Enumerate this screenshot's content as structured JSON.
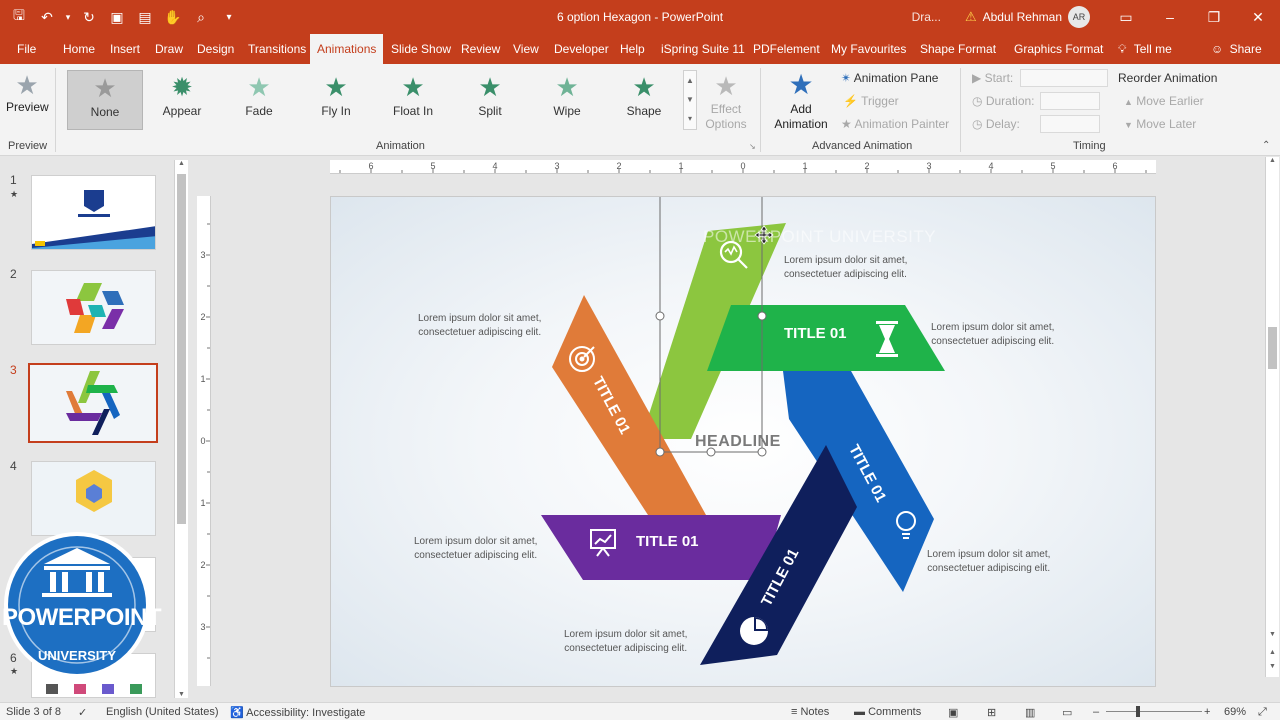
{
  "titlebar": {
    "doc_title": "6 option Hexagon  -  PowerPoint",
    "draw_label": "Dra...",
    "user_name": "Abdul Rehman",
    "user_initials": "AR"
  },
  "tabs": [
    {
      "label": "File"
    },
    {
      "label": "Home"
    },
    {
      "label": "Insert"
    },
    {
      "label": "Draw"
    },
    {
      "label": "Design"
    },
    {
      "label": "Transitions"
    },
    {
      "label": "Animations"
    },
    {
      "label": "Slide Show"
    },
    {
      "label": "Review"
    },
    {
      "label": "View"
    },
    {
      "label": "Developer"
    },
    {
      "label": "Help"
    },
    {
      "label": "iSpring Suite 11"
    },
    {
      "label": "PDFelement"
    },
    {
      "label": "My Favourites"
    },
    {
      "label": "Shape Format"
    },
    {
      "label": "Graphics Format"
    },
    {
      "label": "Tell me"
    },
    {
      "label": "Share"
    }
  ],
  "ribbon": {
    "preview_label": "Preview",
    "preview_group": "Preview",
    "animation_group": "Animation",
    "advanced_group": "Advanced Animation",
    "timing_group": "Timing",
    "gallery": [
      {
        "label": "None",
        "color": "#9a9a9a"
      },
      {
        "label": "Appear",
        "color": "#3a8f6a"
      },
      {
        "label": "Fade",
        "color": "#8fc7b1"
      },
      {
        "label": "Fly In",
        "color": "#3a8f6a"
      },
      {
        "label": "Float In",
        "color": "#3a8f6a"
      },
      {
        "label": "Split",
        "color": "#3a8f6a"
      },
      {
        "label": "Wipe",
        "color": "#6fb396"
      },
      {
        "label": "Shape",
        "color": "#3a8f6a"
      }
    ],
    "effect_options": "Effect Options",
    "add_animation": "Add Animation",
    "animation_pane": "Animation Pane",
    "trigger": "Trigger",
    "animation_painter": "Animation Painter",
    "start": "Start:",
    "duration": "Duration:",
    "delay": "Delay:",
    "reorder": "Reorder Animation",
    "move_earlier": "Move Earlier",
    "move_later": "Move Later"
  },
  "slides": [
    {
      "num": "1",
      "star": "★"
    },
    {
      "num": "2",
      "star": ""
    },
    {
      "num": "3",
      "star": ""
    },
    {
      "num": "4",
      "star": ""
    },
    {
      "num": "6",
      "star": "★"
    }
  ],
  "slide_content": {
    "headline": "HEADLINE",
    "watermark": "POWERPOINT UNIVERSITY",
    "title_green_light": "TITLE 01",
    "title_green": "TITLE 01",
    "title_orange": "TITLE 01",
    "title_blue": "TITLE 01",
    "title_purple": "TITLE 01",
    "title_navy": "TITLE 01",
    "lorem_1": "Lorem ipsum dolor sit amet,",
    "lorem_2": "consectetuer adipiscing elit."
  },
  "colors": {
    "accent": "#c43e1c",
    "green_light": "#8cc63f",
    "green": "#1fb34a",
    "orange": "#e07b39",
    "blue": "#1565c0",
    "purple": "#6a2c9e",
    "navy": "#0f1f5c"
  },
  "status": {
    "slide_of": "Slide 3 of 8",
    "language": "English (United States)",
    "accessibility": "Accessibility: Investigate",
    "notes": "Notes",
    "comments": "Comments",
    "zoom": "69%"
  },
  "logo": {
    "text_top": "POWERPOINT",
    "text_bottom": "UNIVERSITY"
  }
}
